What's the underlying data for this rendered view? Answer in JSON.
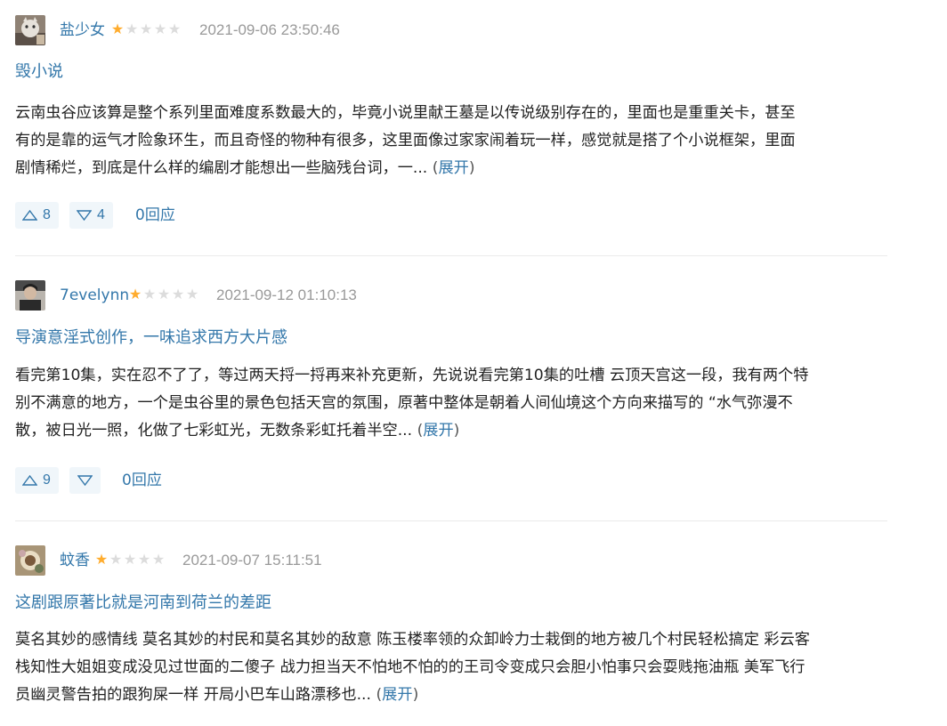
{
  "reviews": [
    {
      "user": "盐少女",
      "rating": 1,
      "time": "2021-09-06 23:50:46",
      "title": "毁小说",
      "lines": [
        "云南虫谷应该算是整个系列里面难度系数最大的，毕竟小说里献王墓是以传说级别存在的，里面也是重重关卡，甚至",
        "有的是靠的运气才险象环生，而且奇怪的物种有很多，这里面像过家家闹着玩一样，感觉就是搭了个小说框架，里面",
        "剧情稀烂，到底是什么样的编剧才能想出一些脑残台词，一..."
      ],
      "expand": "展开",
      "up": "8",
      "down": "4",
      "replies": "0回应"
    },
    {
      "user": "7evelynn",
      "rating": 1,
      "time": "2021-09-12 01:10:13",
      "title": "导演意淫式创作，一味追求西方大片感",
      "lines": [
        "看完第10集，实在忍不了了，等过两天捋一捋再来补充更新，先说说看完第10集的吐槽 云顶天宫这一段，我有两个特",
        "别不满意的地方，一个是虫谷里的景色包括天宫的氛围，原著中整体是朝着人间仙境这个方向来描写的 “水气弥漫不",
        "散，被日光一照，化做了七彩虹光，无数条彩虹托着半空..."
      ],
      "expand": "展开",
      "up": "9",
      "down": "",
      "replies": "0回应"
    },
    {
      "user": "蚊香",
      "rating": 1,
      "time": "2021-09-07 15:11:51",
      "title": "这剧跟原著比就是河南到荷兰的差距",
      "lines": [
        "莫名其妙的感情线 莫名其妙的村民和莫名其妙的敌意 陈玉楼率领的众卸岭力士栽倒的地方被几个村民轻松搞定 彩云客",
        "栈知性大姐姐变成没见过世面的二傻子 战力担当天不怕地不怕的的王司令变成只会胆小怕事只会耍贱拖油瓶 美军飞行",
        "员幽灵警告拍的跟狗屎一样 开局小巴车山路漂移也..."
      ],
      "expand": "展开",
      "up": "",
      "down": "",
      "replies": ""
    }
  ]
}
